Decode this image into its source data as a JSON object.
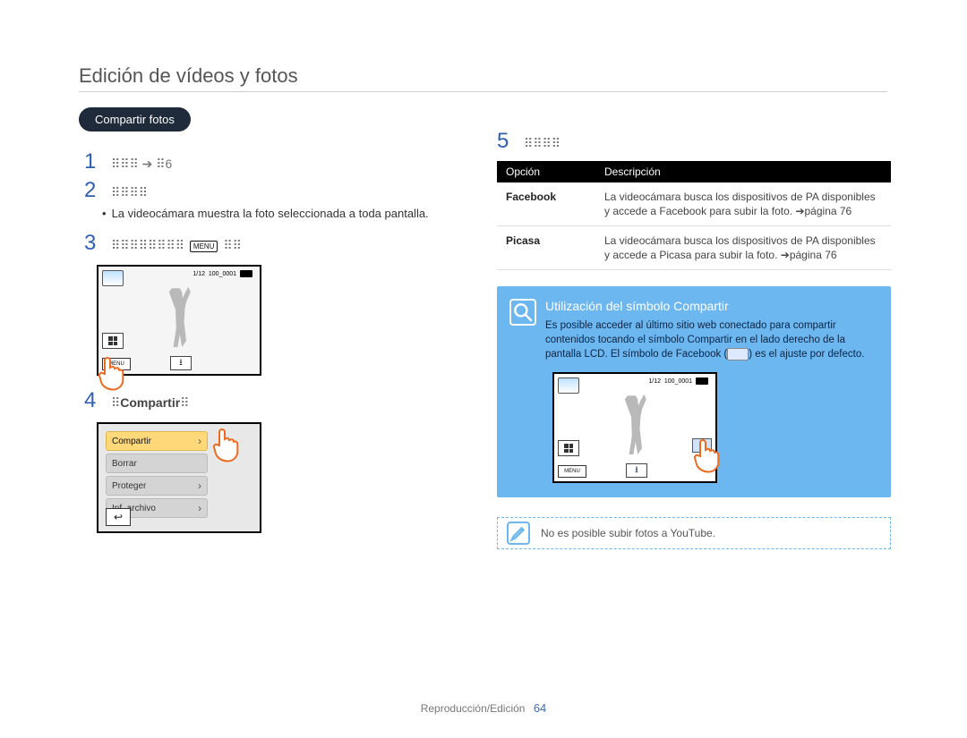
{
  "title": "Edición de vídeos y fotos",
  "section_pill": "Compartir fotos",
  "steps": {
    "n1": "1",
    "s1_garble": "⠿⠿⠿  ➔ ⠿",
    "s1_tail": "6",
    "n2": "2",
    "s2_garble": "⠿⠿⠿⠿",
    "s2_bullet": "La videocámara muestra la foto seleccionada a toda pantalla.",
    "n3": "3",
    "s3_garble_a": "⠿⠿⠿⠿⠿⠿⠿⠿",
    "s3_menu": "MENU",
    "s3_garble_b": "⠿⠿",
    "n4": "4",
    "s4_label_pre": "⠿",
    "s4_label": "Compartir",
    "s4_label_post": "⠿",
    "n5": "5",
    "s5_garble": "⠿⠿⠿⠿"
  },
  "lcd": {
    "counter": "1/12",
    "fileid": "100_0001",
    "menu": "MENU"
  },
  "menulist": {
    "items": [
      "Compartir",
      "Borrar",
      "Proteger",
      "Inf. archivo"
    ]
  },
  "table": {
    "head_option": "Opción",
    "head_desc": "Descripción",
    "rows": [
      {
        "opt": "Facebook",
        "desc": "La videocámara busca los dispositivos de PA disponibles y accede a Facebook para subir la foto. ➔página 76"
      },
      {
        "opt": "Picasa",
        "desc": "La videocámara busca los dispositivos de PA disponibles y accede a Picasa para subir la foto. ➔página 76"
      }
    ]
  },
  "tip": {
    "title": "Utilización del símbolo Compartir",
    "body_a": "Es posible acceder al último sitio web conectado para compartir contenidos tocando el símbolo Compartir en el lado derecho de la pantalla LCD. El símbolo de Facebook (",
    "body_b": ") es el ajuste por defecto."
  },
  "note": "No es posible subir fotos a YouTube.",
  "footer": {
    "section": "Reproducción/Edición",
    "page": "64"
  }
}
